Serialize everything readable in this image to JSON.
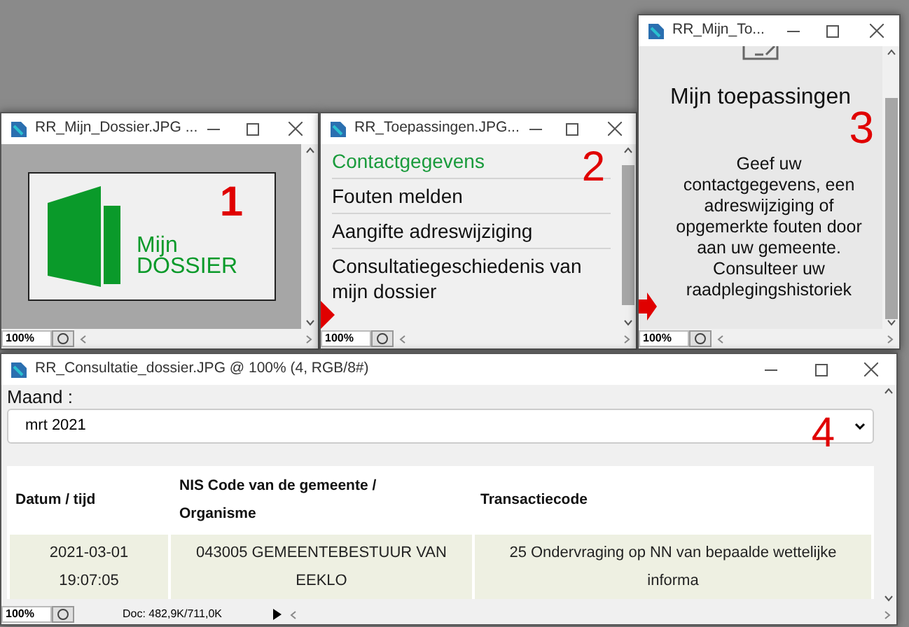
{
  "windows": [
    {
      "kind": "logo",
      "title": "RR_Mijn_Dossier.JPG ...",
      "zoom": "100%",
      "logo_line_1": "Mijn",
      "logo_line_2": "DOSSIER",
      "annotation": "1"
    },
    {
      "kind": "menu",
      "title": "RR_Toepassingen.JPG...",
      "zoom": "100%",
      "annotation": "2",
      "items": [
        {
          "label": "Contactgegevens",
          "selected": true
        },
        {
          "label": "Fouten melden",
          "selected": false
        },
        {
          "label": "Aangifte adreswijziging",
          "selected": false
        },
        {
          "label": "Consultatiegeschiedenis van mijn dossier",
          "selected": false
        }
      ]
    },
    {
      "kind": "info",
      "title": "RR_Mijn_To...",
      "zoom": "100%",
      "annotation": "3",
      "heading": "Mijn toepassingen",
      "body": "Geef uw contactgegevens, een adreswijziging of opgemerkte fouten door aan uw gemeente. Consulteer uw raadplegingshistoriek"
    },
    {
      "kind": "table",
      "title": "RR_Consultatie_dossier.JPG @ 100% (4, RGB/8#)",
      "zoom": "100%",
      "doc": "Doc: 482,9K/711,0K",
      "annotation": "4",
      "field_label": "Maand :",
      "select_value": "mrt 2021",
      "columns": [
        "Datum / tijd",
        "NIS Code van de gemeente / Organisme",
        "Transactiecode"
      ],
      "rows": [
        [
          "2021-03-01 19:07:05",
          "043005 GEMEENTEBESTUUR VAN EEKLO",
          "25 Ondervraging op NN van bepaalde wettelijke informa"
        ]
      ]
    }
  ]
}
